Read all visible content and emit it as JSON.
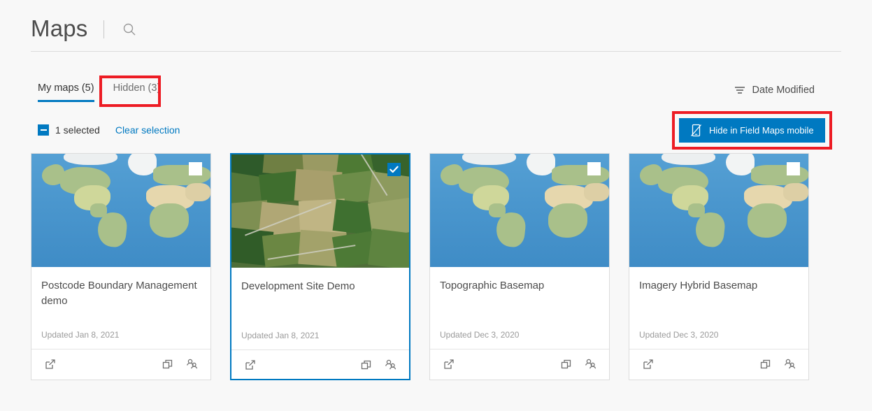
{
  "header": {
    "title": "Maps",
    "search_icon": "search-icon"
  },
  "tabs": [
    {
      "label": "My maps (5)",
      "active": true,
      "name": "tab-my-maps"
    },
    {
      "label": "Hidden (3)",
      "active": false,
      "name": "tab-hidden"
    }
  ],
  "selection": {
    "checkbox_state": "indeterminate",
    "count_label": "1 selected",
    "clear_label": "Clear selection"
  },
  "sort": {
    "icon": "sort-descending-icon",
    "label": "Date Modified"
  },
  "primary_action": {
    "icon": "mobile-hidden-icon",
    "label": "Hide in Field Maps mobile",
    "color": "#0079c1"
  },
  "annotations": {
    "highlight_color": "#ed1c24",
    "boxes": [
      {
        "name": "annotation-box-hidden-tab",
        "target": "tab-hidden"
      },
      {
        "name": "annotation-box-hide-button",
        "target": "hide-in-field-maps-button"
      }
    ]
  },
  "card_footer_icons": [
    {
      "name": "open-external-icon"
    },
    {
      "name": "duplicate-icon"
    },
    {
      "name": "share-group-icon"
    }
  ],
  "cards": [
    {
      "title": "Postcode Boundary Management demo",
      "updated": "Updated Jan 8, 2021",
      "thumbnail": "world-topographic-map",
      "selected": false,
      "checkbox_checked": false
    },
    {
      "title": "Development Site Demo",
      "updated": "Updated Jan 8, 2021",
      "thumbnail": "aerial-imagery-fields",
      "selected": true,
      "checkbox_checked": true
    },
    {
      "title": "Topographic Basemap",
      "updated": "Updated Dec 3, 2020",
      "thumbnail": "world-topographic-map",
      "selected": false,
      "checkbox_checked": false
    },
    {
      "title": "Imagery Hybrid Basemap",
      "updated": "Updated Dec 3, 2020",
      "thumbnail": "world-topographic-map",
      "selected": false,
      "checkbox_checked": false
    }
  ]
}
